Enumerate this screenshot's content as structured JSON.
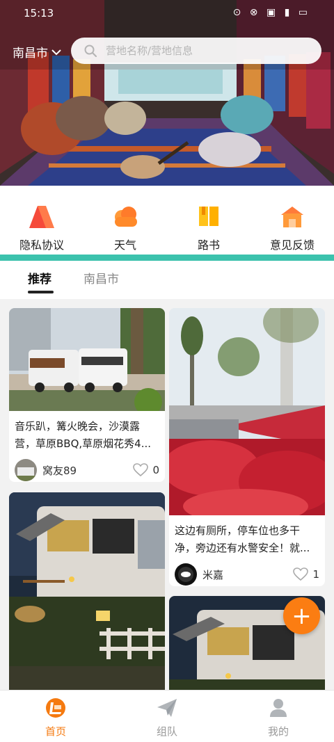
{
  "status_bar": {
    "time": "15:13",
    "icons": "⊙ ⊗ ▣ ▮ ▭"
  },
  "header": {
    "city": "南昌市",
    "search_placeholder": "营地名称/营地信息"
  },
  "quick_nav": [
    {
      "label": "隐私协议",
      "icon": "privacy-triangle-icon"
    },
    {
      "label": "天气",
      "icon": "cloud-weather-icon"
    },
    {
      "label": "路书",
      "icon": "roadbook-book-icon"
    },
    {
      "label": "意见反馈",
      "icon": "feedback-house-icon"
    }
  ],
  "tabs": [
    {
      "label": "推荐",
      "active": true
    },
    {
      "label": "南昌市",
      "active": false
    }
  ],
  "feed": {
    "cards": [
      {
        "title": "音乐趴，篝火晚会，沙漠露营，草原BBQ,草原烟花秀4...",
        "author": "窝友89",
        "likes": "0"
      },
      {
        "title": "这边有厕所，停车位也多干净，旁边还有水警安全！就...",
        "author": "米嘉",
        "likes": "1"
      },
      {
        "title": "",
        "author": "",
        "likes": ""
      },
      {
        "title": "",
        "author": "",
        "likes": ""
      }
    ]
  },
  "fab": {
    "label": "+"
  },
  "bottom_nav": [
    {
      "label": "首页",
      "active": true,
      "icon": "home-logo-icon"
    },
    {
      "label": "组队",
      "active": false,
      "icon": "paper-plane-icon"
    },
    {
      "label": "我的",
      "active": false,
      "icon": "user-icon"
    }
  ],
  "colors": {
    "accent": "#f57a10",
    "teal": "#3cc2ad",
    "fab": "#fb7d12",
    "heart": "#999999"
  }
}
